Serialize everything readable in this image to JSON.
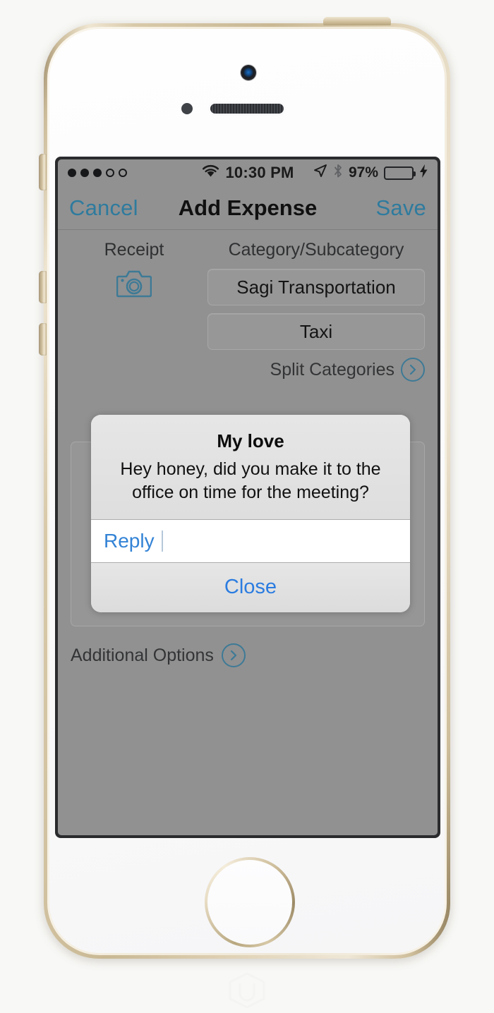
{
  "device": {
    "name": "iphone-5s-gold",
    "frame_color": "#d8c9a9",
    "face_color": "#fbfbfc"
  },
  "status_bar": {
    "signal_dots_total": 5,
    "signal_dots_filled": 3,
    "wifi_icon": "wifi-icon",
    "time": "10:30 PM",
    "location_icon": "location-arrow-icon",
    "bluetooth_icon": "bluetooth-icon",
    "battery_percent": "97%",
    "battery_level": 97,
    "battery_color": "#3fb44a",
    "charging_icon": "lightning-bolt-icon"
  },
  "nav_bar": {
    "cancel_label": "Cancel",
    "title": "Add Expense",
    "save_label": "Save",
    "tint_color": "#2e7b9e"
  },
  "form": {
    "receipt": {
      "label": "Receipt",
      "icon": "camera-icon",
      "icon_color": "#3d7a96"
    },
    "category": {
      "label": "Category/Subcategory",
      "category_value": "Sagi Transportation",
      "subcategory_value": "Taxi",
      "split_link_label": "Split Categories",
      "split_link_icon": "chevron-right-circle-icon"
    },
    "notes_field_value": "",
    "additional_options": {
      "label": "Additional Options",
      "icon": "chevron-right-circle-icon"
    }
  },
  "dialog": {
    "title": "My love",
    "message": "Hey honey, did you make it to the office on time for the meeting?",
    "input": {
      "value": "Reply",
      "placeholder": "Reply",
      "text_color": "#3383d6"
    },
    "close_label": "Close",
    "action_color": "#2b7ce0",
    "background": "#e3e3e3"
  }
}
